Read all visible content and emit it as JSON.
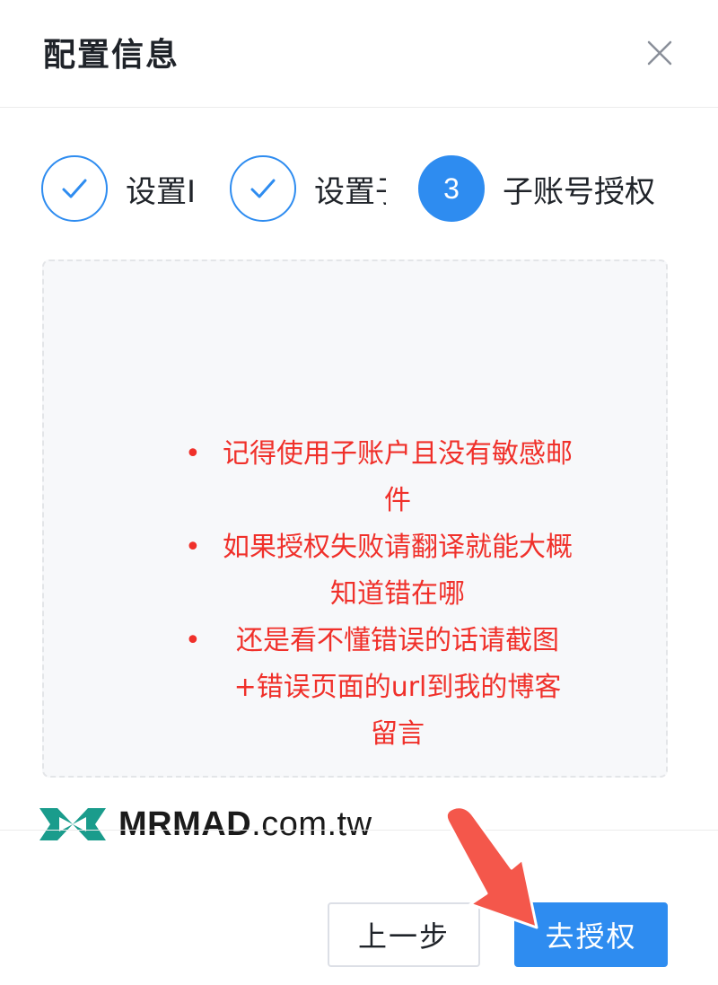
{
  "dialog": {
    "title": "配置信息",
    "close_icon": "close-icon"
  },
  "steps": [
    {
      "label": "设置I",
      "status": "done",
      "icon": "check-icon"
    },
    {
      "label": "设置子",
      "status": "done",
      "icon": "check-icon"
    },
    {
      "number": "3",
      "label": "子账号授权",
      "status": "active"
    }
  ],
  "notes": [
    "记得使用子账户且没有敏感邮件",
    "如果授权失败请翻译就能大概知道错在哪",
    "还是看不懂错误的话请截图+错误页面的url到我的博客留言"
  ],
  "watermark": {
    "bold": "MRMAD",
    "rest": ".com.tw"
  },
  "buttons": {
    "prev_label": "上一步",
    "authorize_label": "去授权"
  },
  "colors": {
    "primary": "#2e8cf0",
    "note_red": "#f0302a",
    "arrow": "#f4574b",
    "logo_teal": "#1a9c8c"
  }
}
